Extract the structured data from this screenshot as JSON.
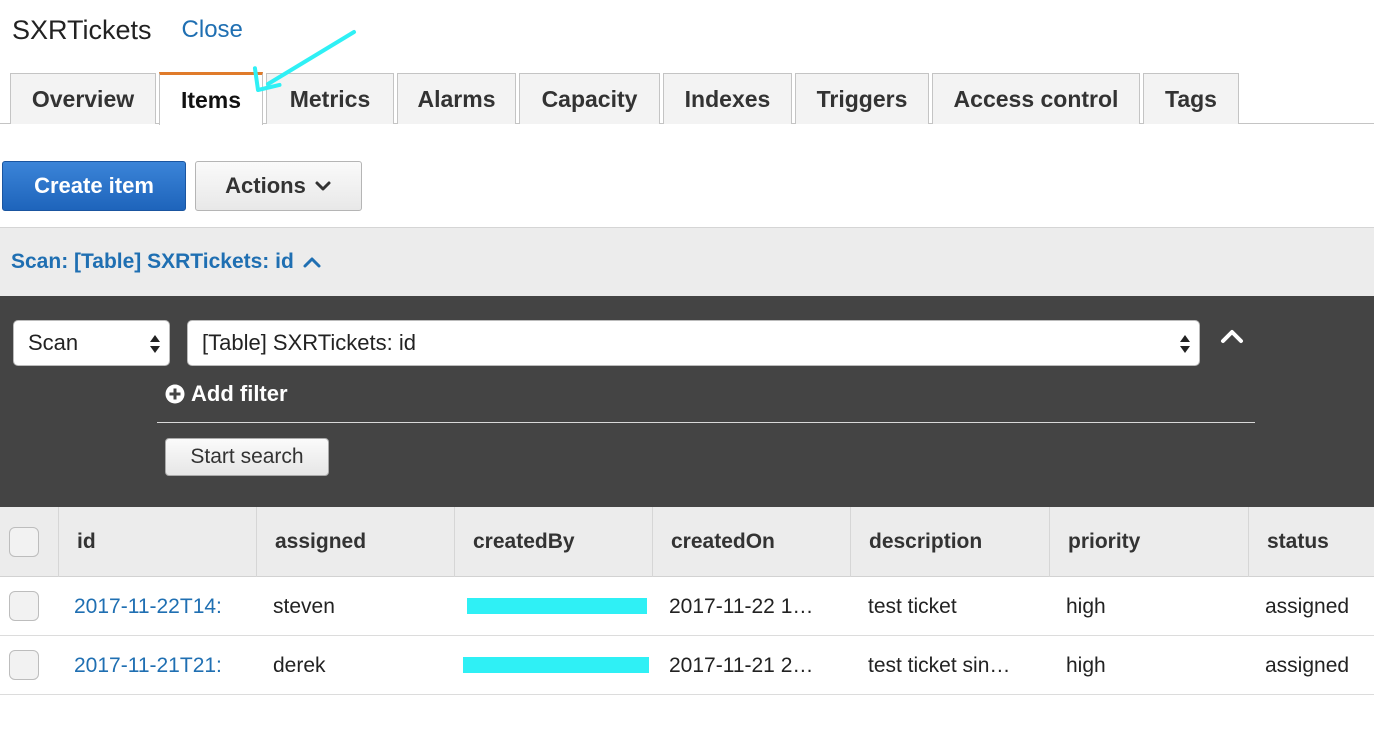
{
  "header": {
    "title": "SXRTickets",
    "close_label": "Close"
  },
  "tabs": [
    {
      "label": "Overview",
      "active": false
    },
    {
      "label": "Items",
      "active": true
    },
    {
      "label": "Metrics",
      "active": false
    },
    {
      "label": "Alarms",
      "active": false
    },
    {
      "label": "Capacity",
      "active": false
    },
    {
      "label": "Indexes",
      "active": false
    },
    {
      "label": "Triggers",
      "active": false
    },
    {
      "label": "Access control",
      "active": false
    },
    {
      "label": "Tags",
      "active": false
    }
  ],
  "toolbar": {
    "create_label": "Create item",
    "actions_label": "Actions"
  },
  "scan_header": {
    "label": "Scan: [Table] SXRTickets: id"
  },
  "filter": {
    "mode_value": "Scan",
    "target_value": "[Table] SXRTickets: id",
    "add_filter_label": "Add filter",
    "start_search_label": "Start search"
  },
  "table": {
    "columns": [
      "id",
      "assigned",
      "createdBy",
      "createdOn",
      "description",
      "priority",
      "status"
    ],
    "rows": [
      {
        "id": "2017-11-22T14:",
        "assigned": "steven",
        "createdBy": "",
        "createdOn": "2017-11-22 1…",
        "description": "test ticket",
        "priority": "high",
        "status": "assigned"
      },
      {
        "id": "2017-11-21T21:",
        "assigned": "derek",
        "createdBy": "",
        "createdOn": "2017-11-21 2…",
        "description": "test ticket sin…",
        "priority": "high",
        "status": "assigned"
      }
    ]
  },
  "colors": {
    "link": "#1f6fb2",
    "primary_button": "#1e64bb",
    "active_tab_accent": "#e07b2a",
    "annotation_arrow": "#2ff0f5",
    "redaction": "#2ff0f5",
    "filter_panel": "#444444"
  },
  "icons": {
    "actions_chevron": "chevron-down-icon",
    "scan_collapse": "chevron-up-icon",
    "add_filter": "plus-circle-icon",
    "select_arrows": "updown-arrows-icon",
    "panel_collapse": "caret-up-icon",
    "annotation": "arrow-annotation-icon"
  }
}
